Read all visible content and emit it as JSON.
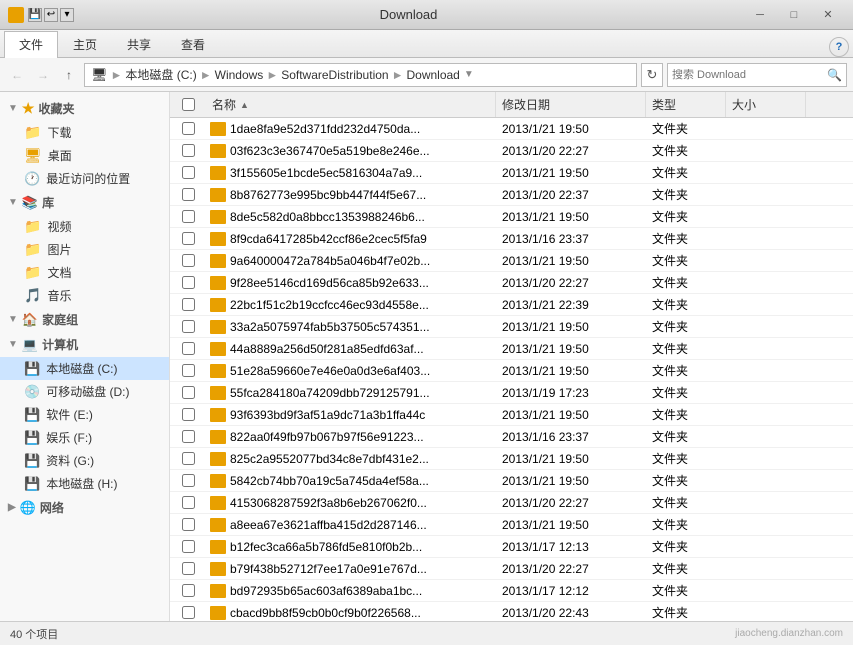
{
  "titlebar": {
    "title": "Download",
    "minimize": "─",
    "maximize": "□",
    "close": "✕"
  },
  "ribbon": {
    "tabs": [
      "文件",
      "主页",
      "共享",
      "查看"
    ]
  },
  "addressbar": {
    "nav_back_disabled": true,
    "nav_forward_disabled": true,
    "path_parts": [
      "本地磁盘 (C:)",
      "Windows",
      "SoftwareDistribution",
      "Download"
    ],
    "search_placeholder": "搜索 Download"
  },
  "sidebar": {
    "sections": [
      {
        "id": "favorites",
        "label": "收藏夹",
        "items": [
          {
            "id": "downloads",
            "label": "下载",
            "icon": "folder"
          },
          {
            "id": "desktop",
            "label": "桌面",
            "icon": "folder"
          },
          {
            "id": "recent",
            "label": "最近访问的位置",
            "icon": "folder"
          }
        ]
      },
      {
        "id": "library",
        "label": "库",
        "items": [
          {
            "id": "videos",
            "label": "视频",
            "icon": "folder"
          },
          {
            "id": "pictures",
            "label": "图片",
            "icon": "folder"
          },
          {
            "id": "documents",
            "label": "文档",
            "icon": "folder"
          },
          {
            "id": "music",
            "label": "音乐",
            "icon": "folder"
          }
        ]
      },
      {
        "id": "homegroup",
        "label": "家庭组",
        "items": []
      },
      {
        "id": "computer",
        "label": "计算机",
        "items": [
          {
            "id": "drive_c",
            "label": "本地磁盘 (C:)",
            "icon": "drive",
            "selected": true
          },
          {
            "id": "drive_d",
            "label": "可移动磁盘 (D:)",
            "icon": "drive"
          },
          {
            "id": "drive_e",
            "label": "软件 (E:)",
            "icon": "drive"
          },
          {
            "id": "drive_f",
            "label": "娱乐 (F:)",
            "icon": "drive"
          },
          {
            "id": "drive_g",
            "label": "资料 (G:)",
            "icon": "drive"
          },
          {
            "id": "drive_h",
            "label": "本地磁盘 (H:)",
            "icon": "drive"
          }
        ]
      },
      {
        "id": "network",
        "label": "网络",
        "items": []
      }
    ]
  },
  "columns": {
    "checkbox": "",
    "name": "名称",
    "date": "修改日期",
    "type": "类型",
    "size": "大小"
  },
  "files": [
    {
      "name": "1dae8fa9e52d371fdd232d4750da...",
      "date": "2013/1/21 19:50",
      "type": "文件夹",
      "size": ""
    },
    {
      "name": "03f623c3e367470e5a519be8e246e...",
      "date": "2013/1/20 22:27",
      "type": "文件夹",
      "size": ""
    },
    {
      "name": "3f155605e1bcde5ec5816304a7a9...",
      "date": "2013/1/21 19:50",
      "type": "文件夹",
      "size": ""
    },
    {
      "name": "8b8762773e995bc9bb447f44f5e67...",
      "date": "2013/1/20 22:37",
      "type": "文件夹",
      "size": ""
    },
    {
      "name": "8de5c582d0a8bbcc1353988246b6...",
      "date": "2013/1/21 19:50",
      "type": "文件夹",
      "size": ""
    },
    {
      "name": "8f9cda6417285b42ccf86e2cec5f5fa9",
      "date": "2013/1/16 23:37",
      "type": "文件夹",
      "size": ""
    },
    {
      "name": "9a640000472a784b5a046b4f7e02b...",
      "date": "2013/1/21 19:50",
      "type": "文件夹",
      "size": ""
    },
    {
      "name": "9f28ee5146cd169d56ca85b92e633...",
      "date": "2013/1/20 22:27",
      "type": "文件夹",
      "size": ""
    },
    {
      "name": "22bc1f51c2b19ccfcc46ec93d4558e...",
      "date": "2013/1/21 22:39",
      "type": "文件夹",
      "size": ""
    },
    {
      "name": "33a2a5075974fab5b37505c574351...",
      "date": "2013/1/21 19:50",
      "type": "文件夹",
      "size": ""
    },
    {
      "name": "44a8889a256d50f281a85edfd63af...",
      "date": "2013/1/21 19:50",
      "type": "文件夹",
      "size": ""
    },
    {
      "name": "51e28a59660e7e46e0a0d3e6af403...",
      "date": "2013/1/21 19:50",
      "type": "文件夹",
      "size": ""
    },
    {
      "name": "55fca284180a74209dbb729125791...",
      "date": "2013/1/19 17:23",
      "type": "文件夹",
      "size": ""
    },
    {
      "name": "93f6393bd9f3af51a9dc71a3b1ffa44c",
      "date": "2013/1/21 19:50",
      "type": "文件夹",
      "size": ""
    },
    {
      "name": "822aa0f49fb97b067b97f56e91223...",
      "date": "2013/1/16 23:37",
      "type": "文件夹",
      "size": ""
    },
    {
      "name": "825c2a9552077bd34c8e7dbf431e2...",
      "date": "2013/1/21 19:50",
      "type": "文件夹",
      "size": ""
    },
    {
      "name": "5842cb74bb70a19c5a745da4ef58a...",
      "date": "2013/1/21 19:50",
      "type": "文件夹",
      "size": ""
    },
    {
      "name": "4153068287592f3a8b6eb267062f0...",
      "date": "2013/1/20 22:27",
      "type": "文件夹",
      "size": ""
    },
    {
      "name": "a8eea67e3621affba415d2d287146...",
      "date": "2013/1/21 19:50",
      "type": "文件夹",
      "size": ""
    },
    {
      "name": "b12fec3ca66a5b786fd5e810f0b2b...",
      "date": "2013/1/17 12:13",
      "type": "文件夹",
      "size": ""
    },
    {
      "name": "b79f438b52712f7ee17a0e91e767d...",
      "date": "2013/1/20 22:27",
      "type": "文件夹",
      "size": ""
    },
    {
      "name": "bd972935b65ac603af6389aba1bc...",
      "date": "2013/1/17 12:12",
      "type": "文件夹",
      "size": ""
    },
    {
      "name": "cbacd9bb8f59cb0b0cf9b0f226568...",
      "date": "2013/1/20 22:43",
      "type": "文件夹",
      "size": ""
    }
  ],
  "statusbar": {
    "count": "40 个项目",
    "watermark": "jiaocheng.dianzhan.com"
  }
}
